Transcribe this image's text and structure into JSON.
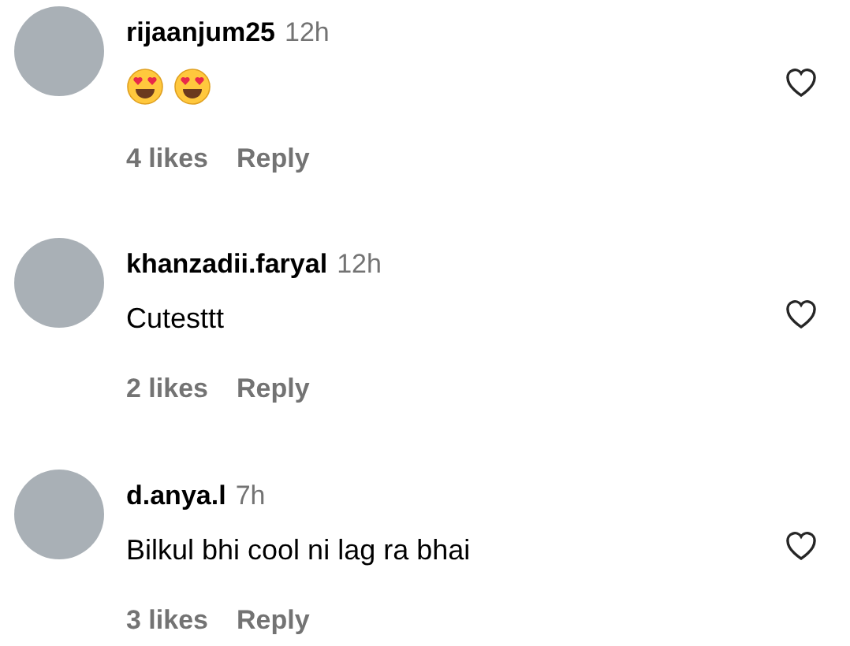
{
  "comments": [
    {
      "username": "rijaanjum25",
      "time": "12h",
      "emojis": [
        {
          "kind": "heart_eyes"
        },
        {
          "kind": "heart_eyes"
        }
      ],
      "likes": "4 likes",
      "reply": "Reply"
    },
    {
      "username": "khanzadii.faryal",
      "time": "12h",
      "text": "Cutesttt",
      "likes": "2 likes",
      "reply": "Reply"
    },
    {
      "username": "d.anya.l",
      "time": "7h",
      "text": "Bilkul bhi cool ni lag ra bhai",
      "likes": "3 likes",
      "reply": "Reply"
    }
  ]
}
